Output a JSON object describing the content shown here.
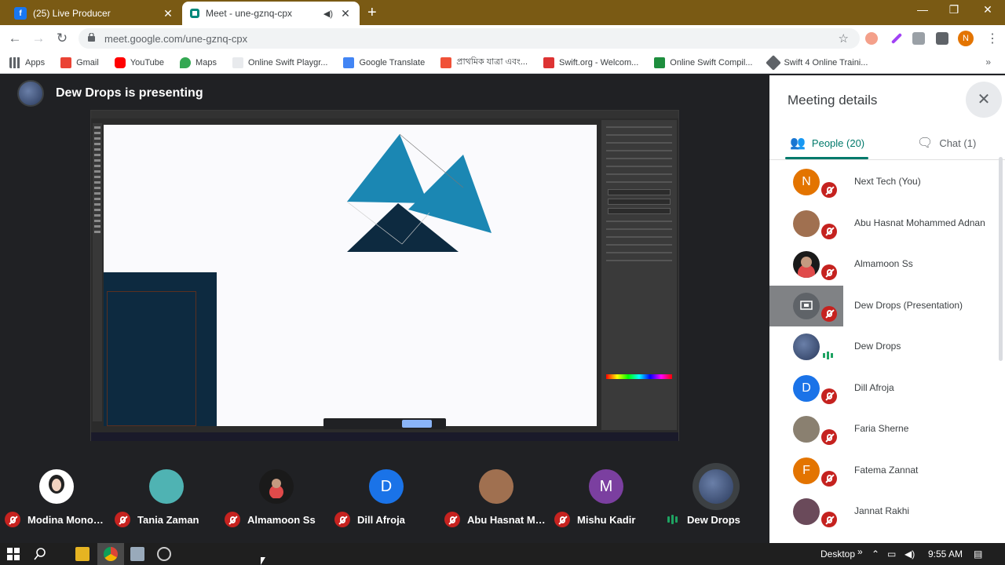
{
  "browser": {
    "tabs": [
      {
        "title": "(25) Live Producer",
        "icon": "facebook-icon",
        "active": false
      },
      {
        "title": "Meet - une-gznq-cpx",
        "icon": "meet-icon",
        "active": true
      }
    ],
    "url": "meet.google.com/une-gznq-cpx",
    "profile_initial": "N",
    "bookmarks": [
      "Apps",
      "Gmail",
      "YouTube",
      "Maps",
      "Online Swift Playgr...",
      "Google Translate",
      "প্রাথমিক যাত্রা এবং...",
      "Swift.org - Welcom...",
      "Online Swift Compil...",
      "Swift 4 Online Traini..."
    ]
  },
  "meet": {
    "presenting_text": "Dew Drops is presenting",
    "participants_strip": [
      {
        "name": "Modina Monow...",
        "initial": "",
        "color": "#ffffff",
        "muted": true
      },
      {
        "name": "Tania Zaman",
        "initial": "",
        "color": "#4fb3b3",
        "muted": true
      },
      {
        "name": "Almamoon Ss",
        "initial": "",
        "color": "#1a1a1a",
        "muted": true
      },
      {
        "name": "Dill Afroja",
        "initial": "D",
        "color": "#1a73e8",
        "muted": true
      },
      {
        "name": "Abu Hasnat Mo...",
        "initial": "",
        "color": "#a07050",
        "muted": true
      },
      {
        "name": "Mishu Kadir",
        "initial": "M",
        "color": "#7b3fa0",
        "muted": true
      },
      {
        "name": "Dew Drops",
        "initial": "",
        "color": "#4a5a80",
        "muted": false
      }
    ]
  },
  "side_panel": {
    "title": "Meeting details",
    "tab_people": "People (20)",
    "tab_chat": "Chat (1)",
    "people": [
      {
        "name": "Next Tech (You)",
        "initial": "N",
        "color": "#e37400",
        "muted": true,
        "highlight": false
      },
      {
        "name": "Abu Hasnat Mohammed Adnan",
        "initial": "",
        "color": "#a07050",
        "muted": true,
        "highlight": false
      },
      {
        "name": "Almamoon Ss",
        "initial": "",
        "color": "#1a1a1a",
        "muted": true,
        "highlight": false
      },
      {
        "name": "Dew Drops (Presentation)",
        "initial": "",
        "color": "#5f6368",
        "muted": true,
        "highlight": true
      },
      {
        "name": "Dew Drops",
        "initial": "",
        "color": "#4a5a80",
        "muted": false,
        "highlight": false
      },
      {
        "name": "Dill Afroja",
        "initial": "D",
        "color": "#1a73e8",
        "muted": true,
        "highlight": false
      },
      {
        "name": "Faria Sherne",
        "initial": "",
        "color": "#8a8070",
        "muted": true,
        "highlight": false
      },
      {
        "name": "Fatema Zannat",
        "initial": "F",
        "color": "#e37400",
        "muted": true,
        "highlight": false
      },
      {
        "name": "Jannat Rakhi",
        "initial": "",
        "color": "#6a4a5a",
        "muted": true,
        "highlight": false
      }
    ]
  },
  "taskbar": {
    "desktop_label": "Desktop",
    "time": "9:55 AM"
  }
}
